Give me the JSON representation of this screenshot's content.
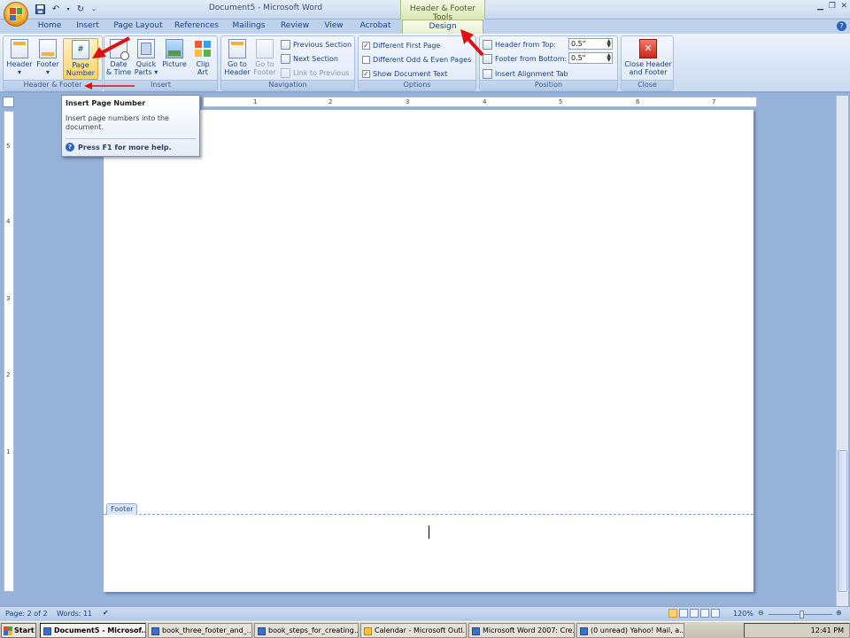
{
  "window": {
    "title": "Document5 - Microsoft Word",
    "context_tab_group": "Header & Footer Tools"
  },
  "tabs": [
    "Home",
    "Insert",
    "Page Layout",
    "References",
    "Mailings",
    "Review",
    "View",
    "Acrobat",
    "Design"
  ],
  "active_tab": "Design",
  "ribbon": {
    "header_footer": {
      "label": "Header & Footer",
      "header": "Header",
      "footer": "Footer",
      "page_number_line1": "Page",
      "page_number_line2": "Number"
    },
    "insert": {
      "label": "Insert",
      "date_time_line1": "Date",
      "date_time_line2": "& Time",
      "quick_parts_line1": "Quick",
      "quick_parts_line2": "Parts",
      "picture": "Picture",
      "clip_art_line1": "Clip",
      "clip_art_line2": "Art"
    },
    "navigation": {
      "label": "Navigation",
      "goto_header_line1": "Go to",
      "goto_header_line2": "Header",
      "goto_footer_line1": "Go to",
      "goto_footer_line2": "Footer",
      "previous_section": "Previous Section",
      "next_section": "Next Section",
      "link_to_previous": "Link to Previous"
    },
    "options": {
      "label": "Options",
      "different_first_page": "Different First Page",
      "different_first_page_checked": true,
      "different_odd_even": "Different Odd & Even Pages",
      "different_odd_even_checked": false,
      "show_document_text": "Show Document Text",
      "show_document_text_checked": true
    },
    "position": {
      "label": "Position",
      "header_from_top": "Header from Top:",
      "header_from_top_value": "0.5\"",
      "footer_from_bottom": "Footer from Bottom:",
      "footer_from_bottom_value": "0.5\"",
      "insert_alignment_tab": "Insert Alignment Tab"
    },
    "close": {
      "label": "Close",
      "close_line1": "Close Header",
      "close_line2": "and Footer"
    }
  },
  "tooltip": {
    "title": "Insert Page Number",
    "body": "Insert page numbers into the document.",
    "help": "Press F1 for more help."
  },
  "document": {
    "footer_label": "Footer"
  },
  "ruler": {
    "h_marks": [
      "1",
      "2",
      "3",
      "4",
      "5",
      "6",
      "7"
    ],
    "v_marks": [
      "5",
      "4",
      "3",
      "2",
      "1"
    ]
  },
  "statusbar": {
    "page": "Page: 2 of 2",
    "words": "Words: 11",
    "zoom": "120%"
  },
  "taskbar": {
    "start": "Start",
    "tasks": [
      "Document5 - Microsof...",
      "book_three_footer_and_...",
      "book_steps_for_creating...",
      "Calendar - Microsoft Outl...",
      "Microsoft Word 2007: Cre...",
      "(0 unread) Yahoo! Mail, a..."
    ],
    "clock": "12:41 PM"
  },
  "colors": {
    "annotation_arrow": "#e01010",
    "highlight": "#ffd36a"
  }
}
